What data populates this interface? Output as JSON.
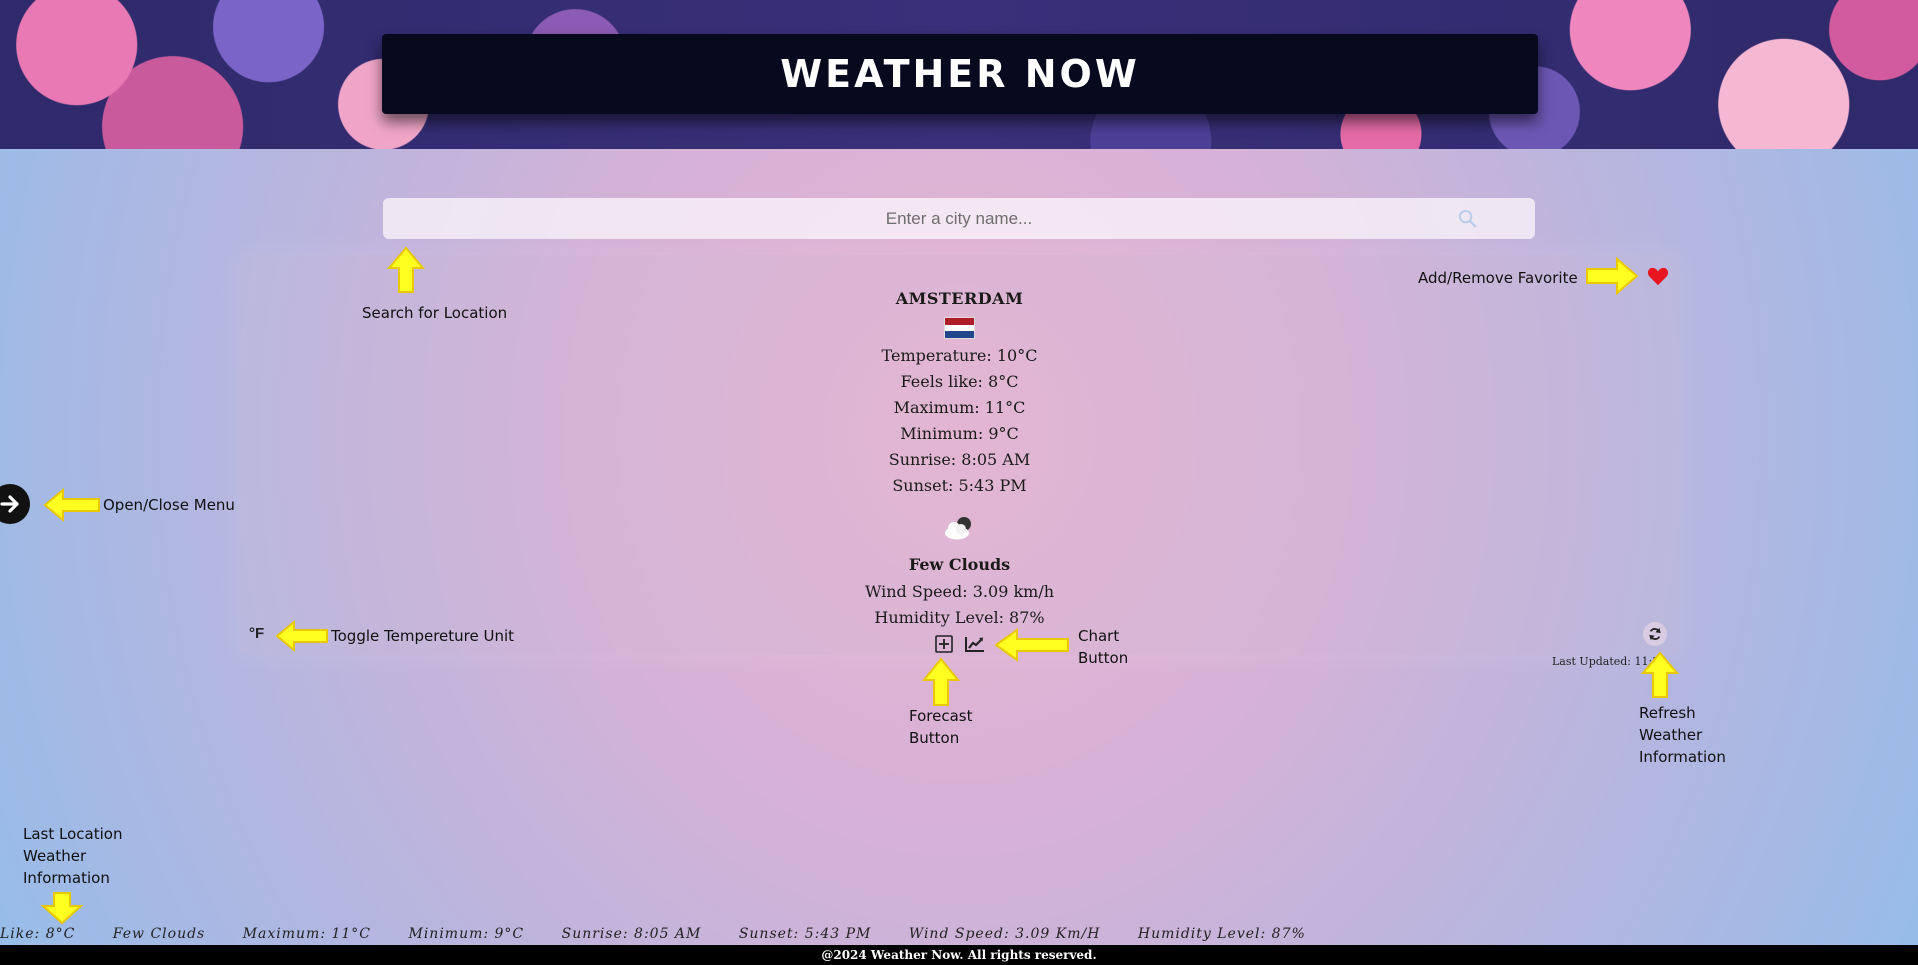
{
  "header": {
    "title": "WEATHER NOW"
  },
  "search": {
    "placeholder": "Enter a city name..."
  },
  "weather": {
    "city": "AMSTERDAM",
    "temperature": "Temperature: 10°C",
    "feels_like": "Feels like: 8°C",
    "maximum": "Maximum: 11°C",
    "minimum": "Minimum: 9°C",
    "sunrise": "Sunrise: 8:05 AM",
    "sunset": "Sunset: 5:43 PM",
    "description": "Few Clouds",
    "wind": "Wind Speed: 3.09 km/h",
    "humidity": "Humidity Level: 87%",
    "icon": "few-clouds-icon"
  },
  "controls": {
    "unit_toggle": "°F",
    "last_updated": "Last Updated: 11:36"
  },
  "annotations": {
    "search": "Search for Location",
    "favorite": "Add/Remove Favorite",
    "menu": "Open/Close Menu",
    "unit": "Toggle Tempereture Unit",
    "chart": [
      "Chart",
      "Button"
    ],
    "forecast": [
      "Forecast",
      "Button"
    ],
    "refresh": [
      "Refresh",
      "Weather",
      "Information"
    ],
    "last_location": [
      "Last Location",
      "Weather",
      "Information"
    ]
  },
  "ticker": [
    "Like: 8°C",
    "Few Clouds",
    "Maximum: 11°C",
    "Minimum: 9°C",
    "Sunrise: 8:05 AM",
    "Sunset: 5:43 PM",
    "Wind Speed: 3.09 Km/H",
    "Humidity Level: 87%"
  ],
  "footer": {
    "text": "@2024 Weather Now. All rights reserved."
  },
  "colors": {
    "accent_heart": "#e8141f",
    "arrow_fill": "#ffff20",
    "flag_red": "#ae1c28",
    "flag_blue": "#21468b"
  }
}
